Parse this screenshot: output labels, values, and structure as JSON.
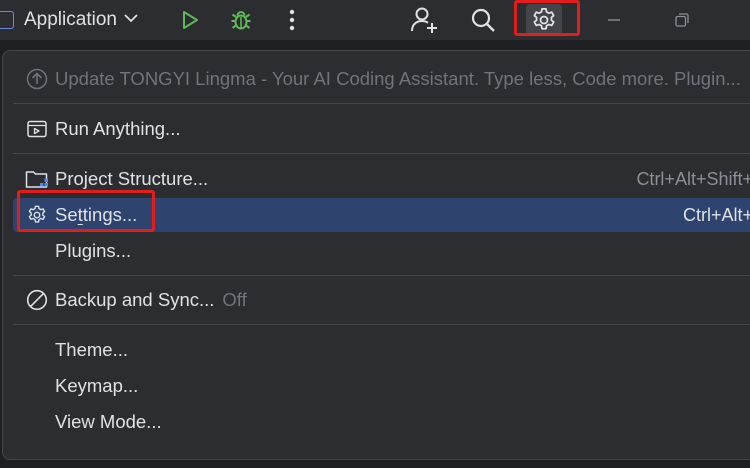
{
  "toolbar": {
    "run_config_label": "Application",
    "icons": [
      "run-config-icon",
      "chevron-down-icon",
      "run-icon",
      "debug-icon",
      "more-vertical-icon",
      "add-user-icon",
      "search-icon",
      "gear-icon",
      "minimize-icon",
      "restore-icon"
    ]
  },
  "menu": {
    "update_label": "Update TONGYI Lingma - Your AI Coding Assistant. Type less, Code more. Plugin...",
    "run_anything_label": "Run Anything...",
    "project_structure_label": "Project Structure...",
    "project_structure_shortcut": "Ctrl+Alt+Shift+",
    "settings_label_pre": "Se",
    "settings_label_u": "t",
    "settings_label_post": "tings...",
    "settings_shortcut": "Ctrl+Alt+",
    "plugins_label": "Plugins...",
    "backup_label": "Backup and Sync...",
    "backup_status": "Off",
    "theme_label": "Theme...",
    "keymap_label": "Keymap...",
    "view_mode_label": "View Mode..."
  },
  "colors": {
    "accent_highlight": "#2e436e",
    "annotation_red": "#e01e1e",
    "run_green": "#5fb85a"
  }
}
